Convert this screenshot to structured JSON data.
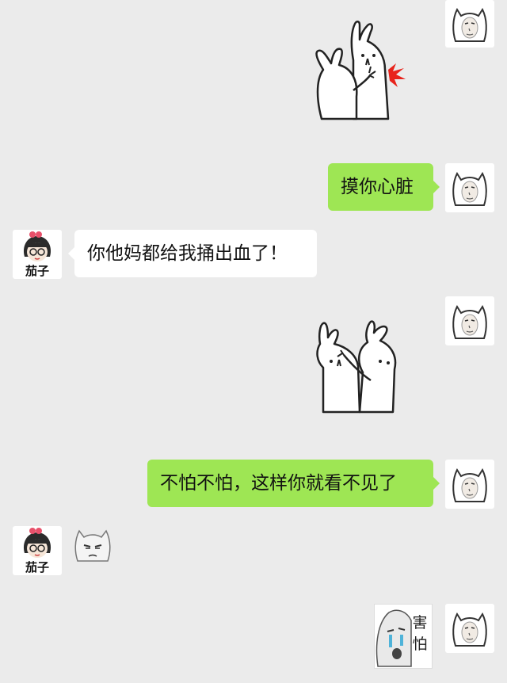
{
  "contacts": {
    "friend": {
      "name": "茄子"
    }
  },
  "messages": [
    {
      "sender": "me",
      "type": "sticker",
      "sticker": "rabbit-poke-heart"
    },
    {
      "sender": "me",
      "type": "text",
      "text": "摸你心脏"
    },
    {
      "sender": "friend",
      "type": "text",
      "text": "你他妈都给我捅出血了！"
    },
    {
      "sender": "me",
      "type": "sticker",
      "sticker": "rabbit-cover-eyes"
    },
    {
      "sender": "me",
      "type": "text",
      "text": "不怕不怕，这样你就看不见了"
    },
    {
      "sender": "friend",
      "type": "sticker",
      "sticker": "grumpy-cat-face"
    },
    {
      "sender": "me",
      "type": "sticker",
      "sticker": "scared-face",
      "caption": "害怕"
    }
  ],
  "colors": {
    "background": "#ebebeb",
    "my_bubble": "#9ee654",
    "friend_bubble": "#ffffff",
    "blood": "#e8231b"
  }
}
